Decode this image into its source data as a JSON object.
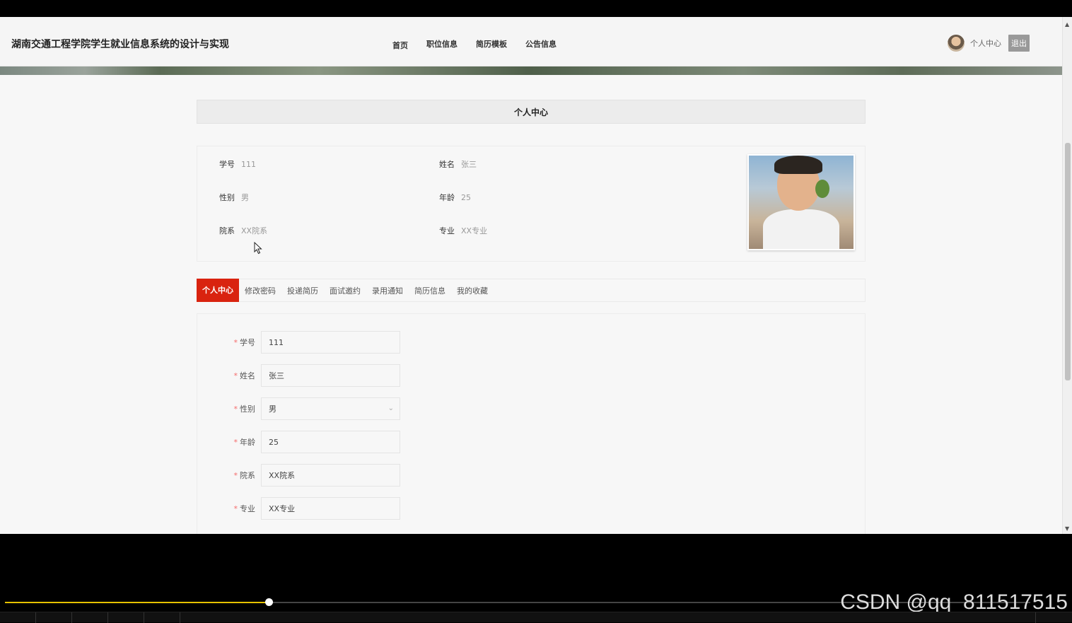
{
  "header": {
    "site_title": "湖南交通工程学院学生就业信息系统的设计与实现",
    "nav": [
      "首页",
      "职位信息",
      "简历模板",
      "公告信息"
    ],
    "user_center": "个人中心",
    "logout": "退出"
  },
  "page": {
    "section_title": "个人中心"
  },
  "profile": {
    "student_id_label": "学号",
    "student_id": "111",
    "name_label": "姓名",
    "name": "张三",
    "gender_label": "性别",
    "gender": "男",
    "age_label": "年龄",
    "age": "25",
    "department_label": "院系",
    "department": "XX院系",
    "major_label": "专业",
    "major": "XX专业"
  },
  "tabs": [
    "个人中心",
    "修改密码",
    "投递简历",
    "面试邀约",
    "录用通知",
    "简历信息",
    "我的收藏"
  ],
  "form": {
    "required_mark": "*",
    "fields": [
      {
        "label": "学号",
        "value": "111"
      },
      {
        "label": "姓名",
        "value": "张三"
      },
      {
        "label": "性别",
        "value": "男"
      },
      {
        "label": "年龄",
        "value": "25"
      },
      {
        "label": "院系",
        "value": "XX院系"
      },
      {
        "label": "专业",
        "value": "XX专业"
      }
    ]
  },
  "player": {
    "progress": 0.257,
    "watermark": "CSDN @qq_811517515"
  },
  "colors": {
    "accent": "#d9230f",
    "progress": "#e6c200"
  }
}
